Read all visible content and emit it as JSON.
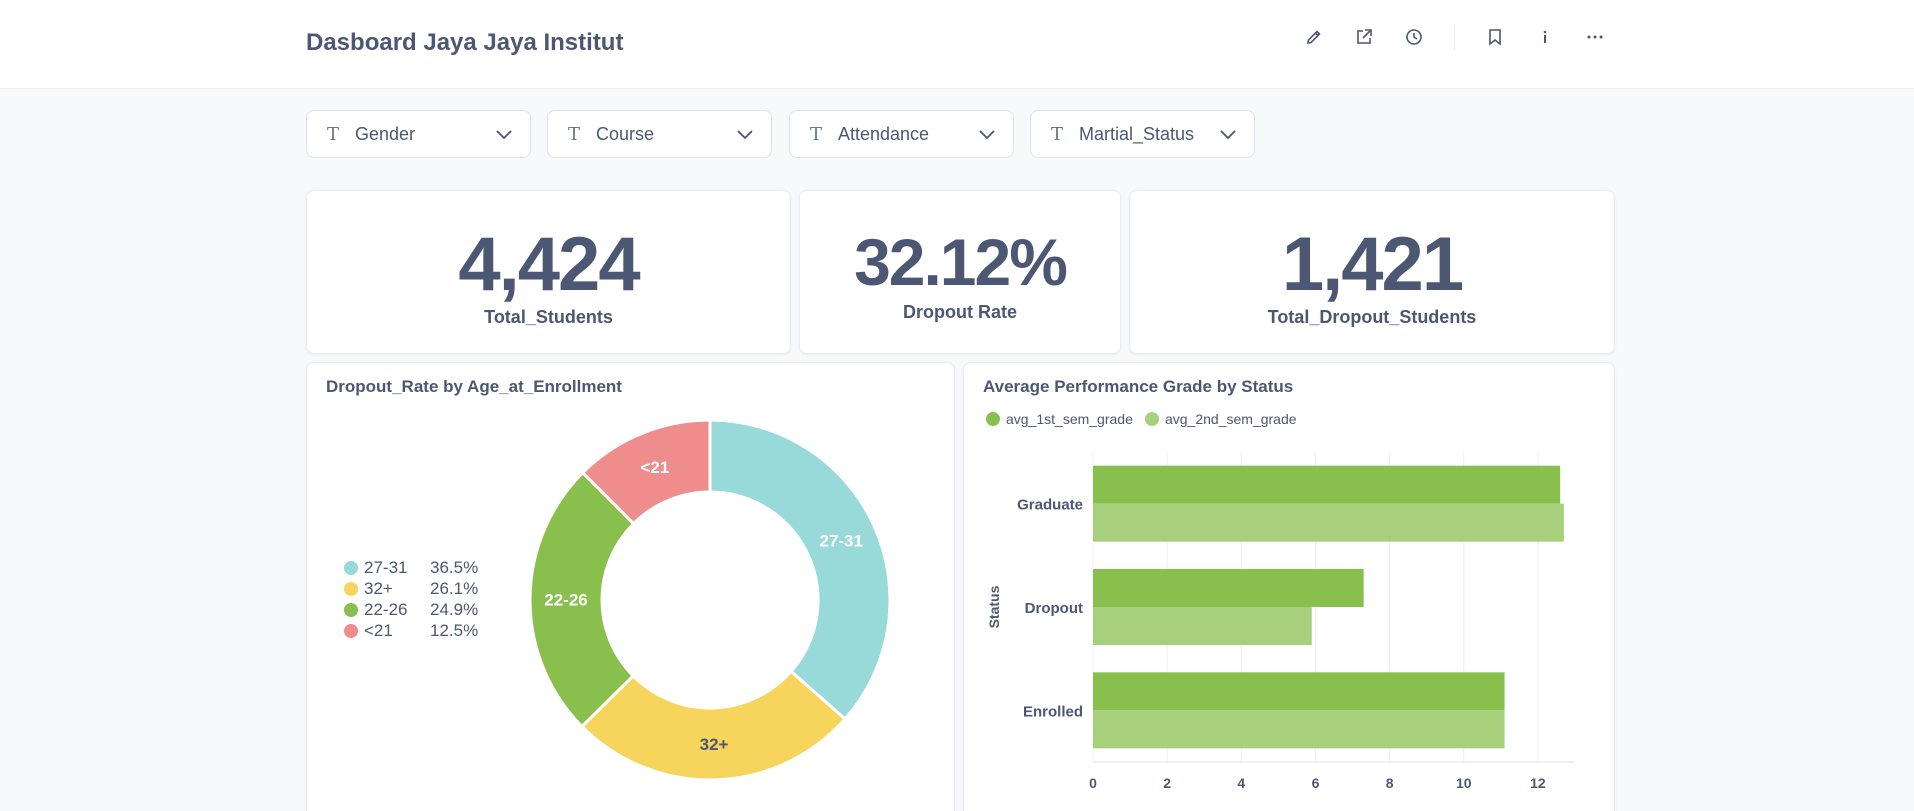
{
  "header": {
    "title": "Dasboard Jaya Jaya Institut"
  },
  "header_icons": [
    "edit-icon",
    "share-icon",
    "history-icon",
    "bookmark-icon",
    "info-icon",
    "more-icon"
  ],
  "filters": [
    {
      "label": "Gender"
    },
    {
      "label": "Course"
    },
    {
      "label": "Attendance"
    },
    {
      "label": "Martial_Status"
    }
  ],
  "kpis": {
    "total_students": {
      "value": "4,424",
      "label": "Total_Students"
    },
    "dropout_rate": {
      "value": "32.12%",
      "label": "Dropout Rate"
    },
    "total_dropout": {
      "value": "1,421",
      "label": "Total_Dropout_Students"
    }
  },
  "colors": {
    "accent_green": "#88bf4d",
    "light_green": "#a7d07c",
    "teal": "#98d9d9",
    "yellow": "#f7d45c",
    "red": "#ef8c8c"
  },
  "chart_data": [
    {
      "type": "pie",
      "title": "Dropout_Rate by Age_at_Enrollment",
      "slices": [
        {
          "label": "27-31",
          "value": 36.5,
          "display": "36.5%",
          "color": "#98d9d9"
        },
        {
          "label": "32+",
          "value": 26.1,
          "display": "26.1%",
          "color": "#f7d45c"
        },
        {
          "label": "22-26",
          "value": 24.9,
          "display": "24.9%",
          "color": "#88bf4d"
        },
        {
          "label": "<21",
          "value": 12.5,
          "display": "12.5%",
          "color": "#ef8c8c"
        }
      ],
      "legend": "left"
    },
    {
      "type": "bar",
      "orientation": "horizontal",
      "title": "Average Performance Grade by Status",
      "categories": [
        "Graduate",
        "Dropout",
        "Enrolled"
      ],
      "series": [
        {
          "name": "avg_1st_sem_grade",
          "values": [
            12.6,
            7.3,
            11.1
          ],
          "color": "#88bf4d"
        },
        {
          "name": "avg_2nd_sem_grade",
          "values": [
            12.7,
            5.9,
            11.1
          ],
          "color": "#a7d07c"
        }
      ],
      "ylabel": "Status",
      "xlim": [
        0,
        13
      ],
      "xticks": [
        0,
        2,
        4,
        6,
        8,
        10,
        12
      ],
      "grid": true,
      "legend": "top-left"
    }
  ]
}
